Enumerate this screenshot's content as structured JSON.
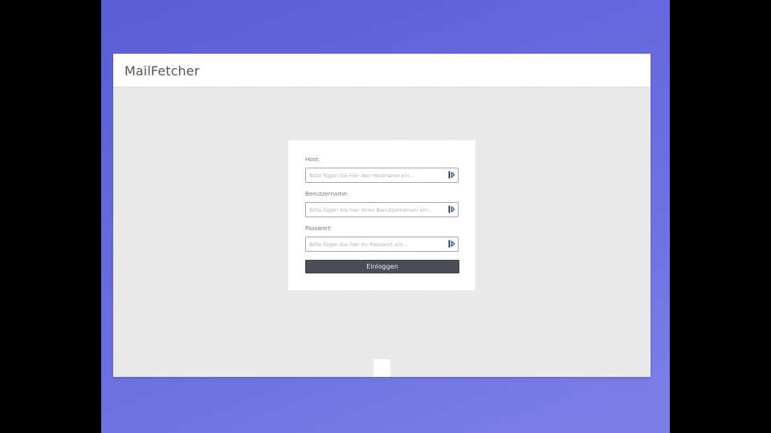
{
  "app": {
    "title": "MailFetcher"
  },
  "login_form": {
    "host": {
      "label": "Host:",
      "placeholder": "Bitte fügen Sie hier den Hostname ein...",
      "value": ""
    },
    "username": {
      "label": "Benutzername:",
      "placeholder": "Bitte fügen Sie hier Ihren Benutzernamen ein...",
      "value": ""
    },
    "password": {
      "label": "Passwort:",
      "placeholder": "Bitte fügen Sie hier Ihr Passwort ein...",
      "value": ""
    },
    "submit_label": "Einloggen"
  },
  "icons": {
    "field_autofill": "password-manager-icon"
  },
  "colors": {
    "background_gradient_start": "#5a5fd6",
    "background_gradient_end": "#7c80e6",
    "button": "#4b4f55",
    "autofill_icon": "#1f3b57"
  }
}
